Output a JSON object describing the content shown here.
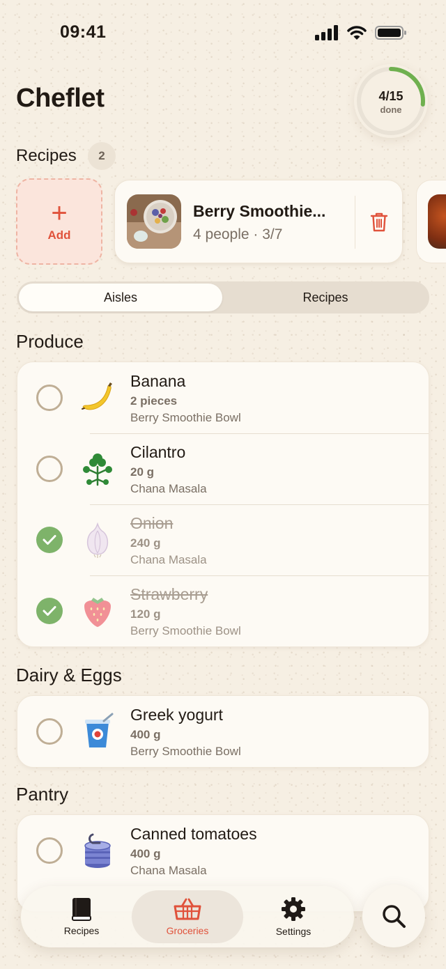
{
  "status_bar": {
    "time": "09:41"
  },
  "header": {
    "title": "Cheflet"
  },
  "progress": {
    "count": "4/15",
    "label": "done",
    "fraction": 0.2667,
    "color": "#6fb04f"
  },
  "recipes_section": {
    "label": "Recipes",
    "count": "2"
  },
  "add_card": {
    "label": "Add"
  },
  "recipe_cards": [
    {
      "title": "Berry Smoothie...",
      "meta": "4 people · 3/7"
    }
  ],
  "view_toggle": {
    "options": [
      "Aisles",
      "Recipes"
    ],
    "selected": "Aisles"
  },
  "aisles": [
    {
      "title": "Produce",
      "items": [
        {
          "name": "Banana",
          "quantity": "2 pieces",
          "source": "Berry Smoothie Bowl",
          "checked": false,
          "icon": "banana-icon"
        },
        {
          "name": "Cilantro",
          "quantity": "20 g",
          "source": "Chana Masala",
          "checked": false,
          "icon": "herb-icon"
        },
        {
          "name": "Onion",
          "quantity": "240 g",
          "source": "Chana Masala",
          "checked": true,
          "icon": "onion-icon"
        },
        {
          "name": "Strawberry",
          "quantity": "120 g",
          "source": "Berry Smoothie Bowl",
          "checked": true,
          "icon": "strawberry-icon"
        }
      ]
    },
    {
      "title": "Dairy & Eggs",
      "items": [
        {
          "name": "Greek yogurt",
          "quantity": "400 g",
          "source": "Berry Smoothie Bowl",
          "checked": false,
          "icon": "yogurt-icon"
        }
      ]
    },
    {
      "title": "Pantry",
      "items": [
        {
          "name": "Canned tomatoes",
          "quantity": "400 g",
          "source": "Chana Masala",
          "checked": false,
          "icon": "can-icon"
        }
      ]
    }
  ],
  "tab_bar": {
    "tabs": [
      {
        "label": "Recipes",
        "icon": "book-icon"
      },
      {
        "label": "Groceries",
        "icon": "basket-icon",
        "active": true
      },
      {
        "label": "Settings",
        "icon": "gear-icon"
      }
    ],
    "search_icon": "search-icon"
  },
  "colors": {
    "accent": "#e0523b",
    "check_done": "#7eb36a",
    "background": "#f6efe3"
  }
}
